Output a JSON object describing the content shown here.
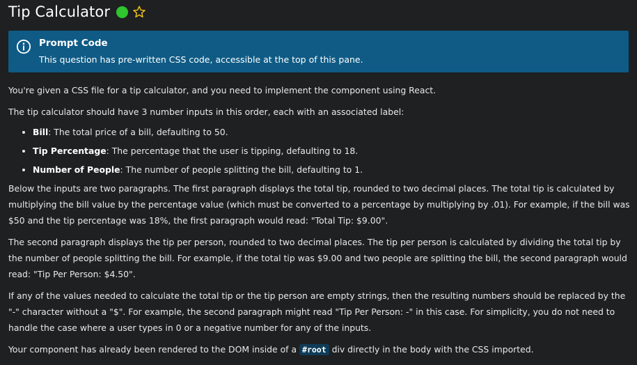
{
  "header": {
    "title": "Tip Calculator",
    "status_color": "#2ec52e",
    "status_icon": "completed-status-dot",
    "favorite_icon": "star-icon"
  },
  "callout": {
    "icon": "info-icon",
    "title": "Prompt Code",
    "text": "This question has pre-written CSS code, accessible at the top of this pane.",
    "background": "#0f5b85"
  },
  "content": {
    "intro": "You're given a CSS file for a tip calculator, and you need to implement the component using React.",
    "inputs_intro": "The tip calculator should have 3 number inputs in this order, each with an associated label:",
    "inputs": [
      {
        "name": "Bill",
        "desc": ": The total price of a bill, defaulting to 50."
      },
      {
        "name": "Tip Percentage",
        "desc": ": The percentage that the user is tipping, defaulting to 18."
      },
      {
        "name": "Number of People",
        "desc": ": The number of people splitting the bill, defaulting to 1."
      }
    ],
    "para_total_tip": "Below the inputs are two paragraphs. The first paragraph displays the total tip, rounded to two decimal places. The total tip is calculated by multiplying the bill value by the percentage value (which must be converted to a percentage by multiplying by .01). For example, if the bill was $50 and the tip percentage was 18%, the first paragraph would read: \"Total Tip: $9.00\".",
    "para_per_person": "The second paragraph displays the tip per person, rounded to two decimal places. The tip per person is calculated by dividing the total tip by the number of people splitting the bill. For example, if the total tip was $9.00 and two people are splitting the bill, the second paragraph would read: \"Tip Per Person: $4.50\".",
    "para_empty": "If any of the values needed to calculate the total tip or the tip person are empty strings, then the resulting numbers should be replaced by the \"-\" character without a \"$\". For example, the second paragraph might read \"Tip Per Person: -\" in this case. For simplicity, you do not need to handle the case where a user types in 0 or a negative number for any of the inputs.",
    "closing_before": "Your component has already been rendered to the DOM inside of a ",
    "closing_code": "#root",
    "closing_after": " div directly in the body with the CSS imported."
  }
}
